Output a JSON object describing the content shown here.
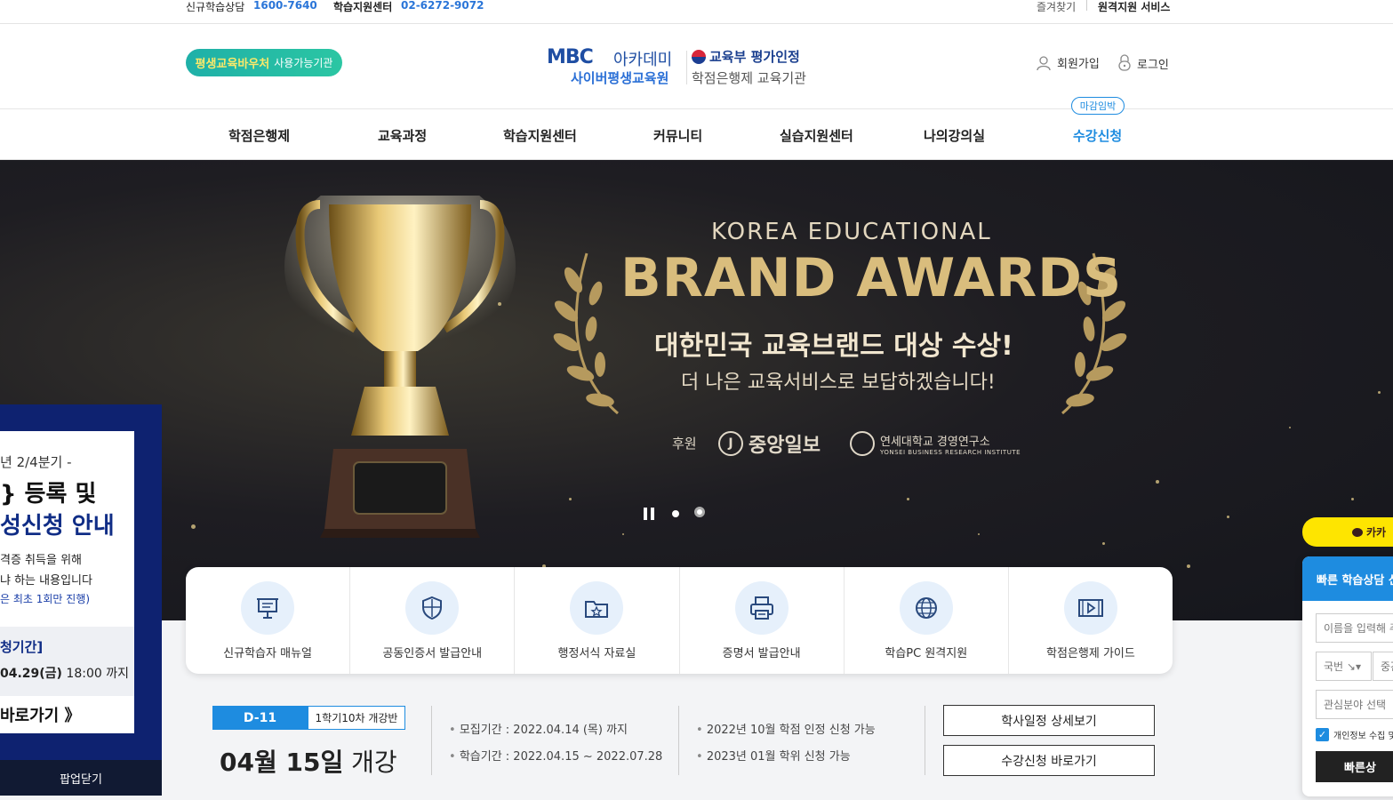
{
  "topbar": {
    "consult_label": "신규학습상담",
    "consult_phone": "1600-7640",
    "center_label": "학습지원센터",
    "center_phone": "02-6272-9072",
    "favorites": "즐겨찾기",
    "remote": "원격지원 서비스"
  },
  "header": {
    "badge_strong": "평생교육바우처",
    "badge_text": "사용가능기관",
    "logo_mbc": "MBC",
    "logo_academy": "아카데미",
    "logo_cyber": "사이버평생교육원",
    "logo_ministry": "교육부 평가인정",
    "logo_credit": "학점은행제 교육기관",
    "signup": "회원가입",
    "login": "로그인"
  },
  "nav": {
    "items": [
      "학점은행제",
      "교육과정",
      "학습지원센터",
      "커뮤니티",
      "실습지원센터",
      "나의강의실",
      "수강신청"
    ],
    "deadline_badge": "마감임박"
  },
  "hero": {
    "line1": "KOREA EDUCATIONAL",
    "line2": "BRAND AWARDS",
    "line3": "대한민국 교육브랜드 대상 수상!",
    "line4": "더 나은 교육서비스로 보답하겠습니다!",
    "sponsor_label": "후원",
    "sponsor1": "중앙일보",
    "sponsor2": "연세대학교 경영연구소",
    "sponsor2_en": "YONSEI BUSINESS RESEARCH INSTITUTE"
  },
  "quick_menu": [
    {
      "label": "신규학습자 매뉴얼",
      "icon": "presentation-icon"
    },
    {
      "label": "공동인증서 발급안내",
      "icon": "shield-icon"
    },
    {
      "label": "행정서식 자료실",
      "icon": "folder-star-icon"
    },
    {
      "label": "증명서 발급안내",
      "icon": "printer-icon"
    },
    {
      "label": "학습PC 원격지원",
      "icon": "globe-icon"
    },
    {
      "label": "학점은행제 가이드",
      "icon": "video-icon"
    }
  ],
  "schedule": {
    "d_day": "D-11",
    "class_name": "1학기10차 개강반",
    "open_month_day": "04월 15일",
    "open_word": "개강",
    "recruit": "모집기간 : 2022.04.14 (목) 까지",
    "study": "학습기간 : 2022.04.15 ~ 2022.07.28",
    "credit_apply": "2022년 10월 학점 인정 신청 가능",
    "degree_apply": "2023년 01월 학위 신청 가능",
    "btn_calendar": "학사일정 상세보기",
    "btn_apply": "수강신청 바로가기"
  },
  "popup": {
    "line1": "년 2/4분기 -",
    "line2": "} 등록 및",
    "line3": "성신청 안내",
    "line4": "격증 취득을 위해",
    "line5": "냐 하는 내용입니다",
    "line6": "은 최초 1회만 진행)",
    "period_label": "청기간]",
    "period_date": "04.29(금)",
    "period_time": "18:00 까지",
    "goto": "바로가기 》",
    "close": "팝업닫기"
  },
  "float": {
    "kakao": "카카",
    "consult_title": "빠른 학습상담 신",
    "name_placeholder": "이름을 입력해 주",
    "country": "국번 ↘▾",
    "middle": "중간",
    "field": "관심분야 선택",
    "privacy": "개인정보 수집 및",
    "submit": "빠른상"
  }
}
